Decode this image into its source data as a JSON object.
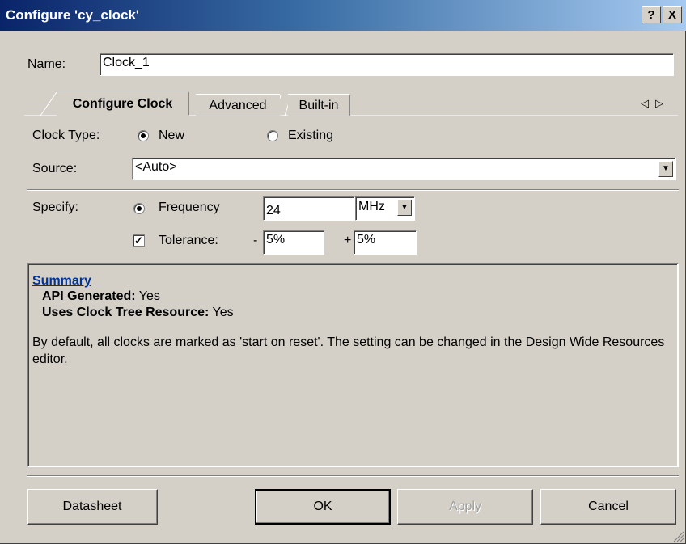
{
  "window": {
    "title": "Configure 'cy_clock'",
    "help_label": "?",
    "close_label": "X"
  },
  "name": {
    "label": "Name:",
    "value": "Clock_1"
  },
  "tabs": [
    {
      "label": "Configure Clock",
      "active": true
    },
    {
      "label": "Advanced",
      "active": false
    },
    {
      "label": "Built-in",
      "active": false
    }
  ],
  "tab_scroll": {
    "left": "◁",
    "right": "▷"
  },
  "clock_type": {
    "label": "Clock Type:",
    "options": [
      "New",
      "Existing"
    ],
    "selected": "New"
  },
  "source": {
    "label": "Source:",
    "value": "<Auto>"
  },
  "specify": {
    "label": "Specify:",
    "frequency_label": "Frequency",
    "frequency_value": "24",
    "unit": "MHz",
    "tolerance_label": "Tolerance:",
    "tolerance_checked": true,
    "minus_sign": "-",
    "minus_value": "5%",
    "plus_sign": "+",
    "plus_value": "5%"
  },
  "summary": {
    "heading": "Summary",
    "api_label": "API Generated:",
    "api_value": "Yes",
    "tree_label": "Uses Clock Tree Resource:",
    "tree_value": "Yes",
    "note": "By default, all clocks are marked as 'start on reset'. The setting can be changed in the Design Wide Resources editor."
  },
  "buttons": {
    "datasheet": "Datasheet",
    "ok": "OK",
    "apply": "Apply",
    "cancel": "Cancel"
  },
  "colors": {
    "face": "#d4d0c8",
    "title_start": "#0a246a",
    "title_end": "#a6caf0",
    "link": "#003399"
  }
}
